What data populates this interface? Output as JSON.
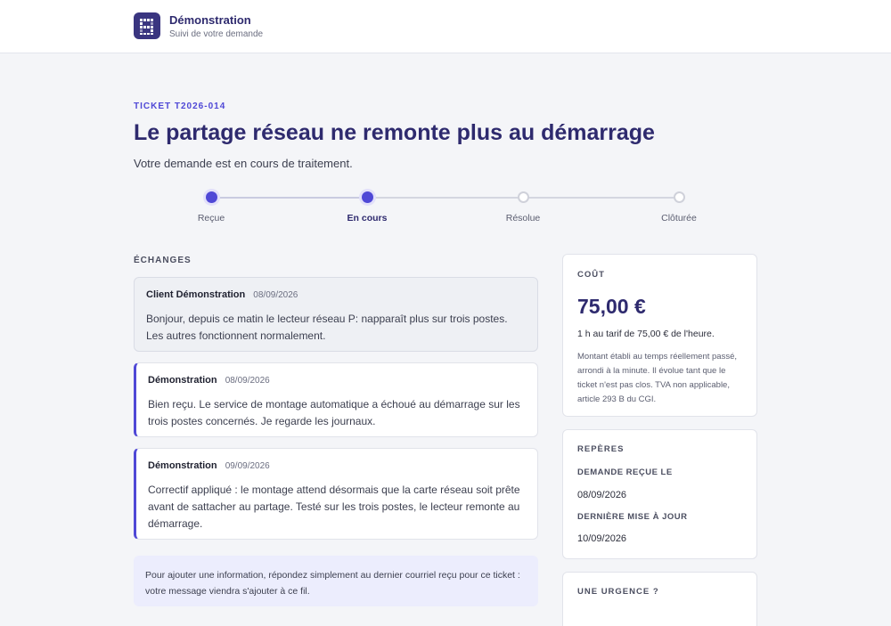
{
  "header": {
    "brand_name": "Démonstration",
    "brand_subtitle": "Suivi de votre demande"
  },
  "ticket": {
    "id_label": "TICKET T2026-014",
    "title": "Le partage réseau ne remonte plus au démarrage",
    "status_text": "Votre demande est en cours de traitement."
  },
  "stepper": {
    "steps": [
      {
        "label": "Reçue",
        "state": "done"
      },
      {
        "label": "En cours",
        "state": "current"
      },
      {
        "label": "Résolue",
        "state": "todo"
      },
      {
        "label": "Clôturée",
        "state": "todo"
      }
    ]
  },
  "exchanges": {
    "label": "ÉCHANGES",
    "messages": [
      {
        "author": "Client Démonstration",
        "date": "08/09/2026",
        "body": "Bonjour, depuis ce matin le lecteur réseau P: napparaît plus sur trois postes. Les autres fonctionnent normalement."
      },
      {
        "author": "Démonstration",
        "date": "08/09/2026",
        "body": "Bien reçu. Le service de montage automatique a échoué au démarrage sur les trois postes concernés. Je regarde les journaux."
      },
      {
        "author": "Démonstration",
        "date": "09/09/2026",
        "body": "Correctif appliqué : le montage attend désormais que la carte réseau soit prête avant de sattacher au partage. Testé sur les trois postes, le lecteur remonte au démarrage."
      }
    ],
    "note": "Pour ajouter une information, répondez simplement au dernier courriel reçu pour ce ticket : votre message viendra s'ajouter à ce fil."
  },
  "cost": {
    "title": "COÛT",
    "amount": "75,00 €",
    "detail": "1 h au tarif de 75,00 € de l'heure.",
    "note": "Montant établi au temps réellement passé, arrondi à la minute. Il évolue tant que le ticket n'est pas clos. TVA non applicable, article 293 B du CGI."
  },
  "landmarks": {
    "title": "REPÈRES",
    "received_label": "DEMANDE REÇUE LE",
    "received_value": "08/09/2026",
    "updated_label": "DERNIÈRE MISE À JOUR",
    "updated_value": "10/09/2026"
  },
  "urgency": {
    "title": "UNE URGENCE ?"
  },
  "colors": {
    "accent": "#4f48d6",
    "brand": "#2e2a6e"
  }
}
